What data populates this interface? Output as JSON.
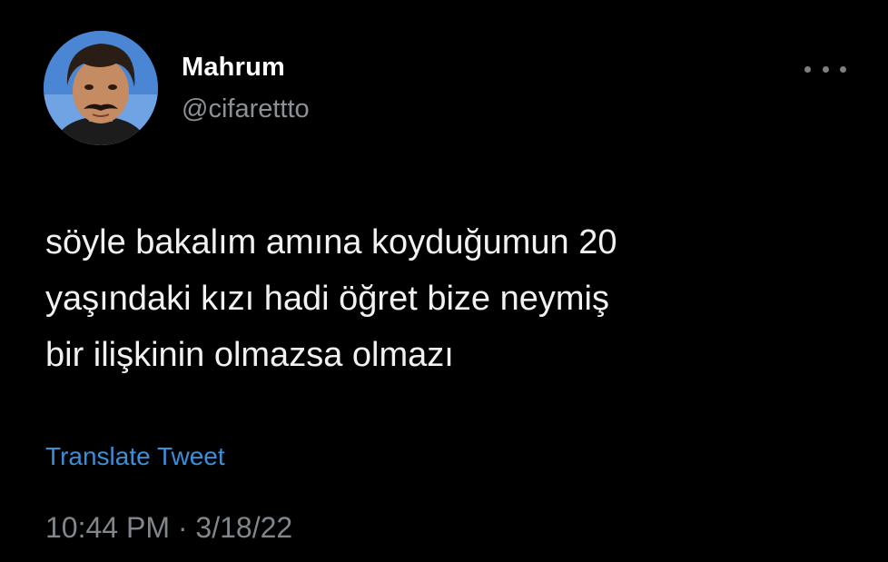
{
  "tweet": {
    "author": {
      "display_name": "Mahrum",
      "handle": "@cifarettto",
      "avatar_icon": "profile-avatar"
    },
    "more_icon": "more-options-icon",
    "text": "söyle bakalım amına koyduğumun 20\nyaşındaki kızı hadi öğret bize neymiş\nbir ilişkinin olmazsa olmazı",
    "translate_label": "Translate Tweet",
    "time": "10:44 PM",
    "separator": "·",
    "date": "3/18/22"
  },
  "colors": {
    "background": "#000000",
    "name": "#ffffff",
    "handle": "#8b9196",
    "link": "#3b8fd8",
    "meta": "#80868b"
  }
}
